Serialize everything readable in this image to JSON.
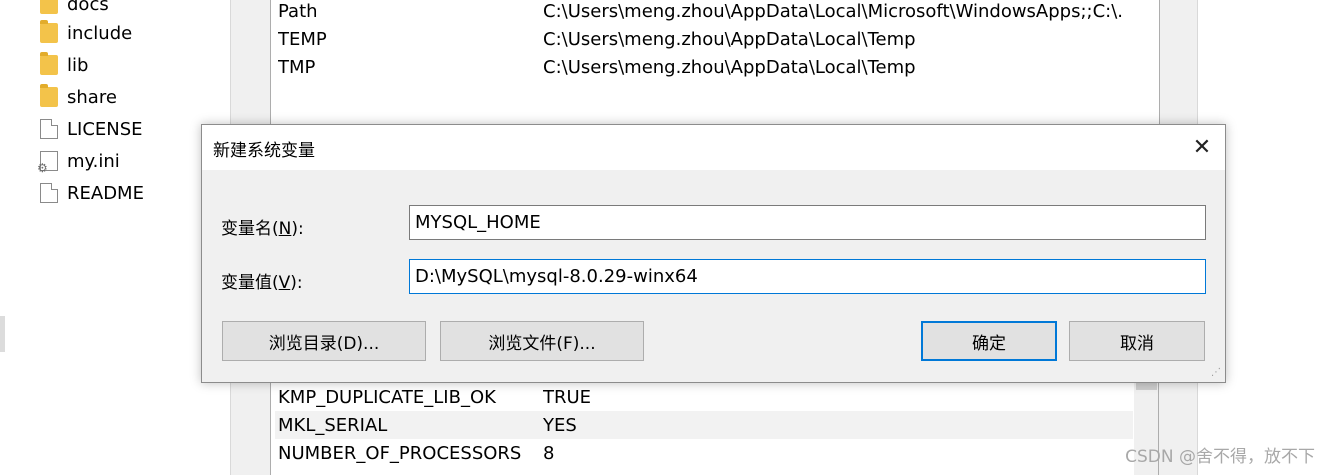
{
  "explorer": {
    "items": [
      {
        "label": "docs",
        "icon": "folder-icon"
      },
      {
        "label": "include",
        "icon": "folder-icon"
      },
      {
        "label": "lib",
        "icon": "folder-icon"
      },
      {
        "label": "share",
        "icon": "folder-icon"
      },
      {
        "label": "LICENSE",
        "icon": "file-icon"
      },
      {
        "label": "my.ini",
        "icon": "config-file-icon"
      },
      {
        "label": "README",
        "icon": "file-icon"
      }
    ]
  },
  "user_variables": {
    "rows": [
      {
        "name": "Path",
        "value": "C:\\Users\\meng.zhou\\AppData\\Local\\Microsoft\\WindowsApps;;C:\\..."
      },
      {
        "name": "TEMP",
        "value": "C:\\Users\\meng.zhou\\AppData\\Local\\Temp"
      },
      {
        "name": "TMP",
        "value": "C:\\Users\\meng.zhou\\AppData\\Local\\Temp"
      }
    ]
  },
  "system_variables": {
    "rows": [
      {
        "name": "KMP_DUPLICATE_LIB_OK",
        "value": "TRUE"
      },
      {
        "name": "MKL_SERIAL",
        "value": "YES"
      },
      {
        "name": "NUMBER_OF_PROCESSORS",
        "value": "8"
      }
    ]
  },
  "dialog": {
    "title": "新建系统变量",
    "close_glyph": "✕",
    "name_label_prefix": "变量名(",
    "name_label_key": "N",
    "name_label_suffix": "):",
    "name_value": "MYSQL_HOME",
    "value_label_prefix": "变量值(",
    "value_label_key": "V",
    "value_label_suffix": "):",
    "value_value": "D:\\MySQL\\mysql-8.0.29-winx64",
    "browse_dir_label": "浏览目录(D)...",
    "browse_file_label": "浏览文件(F)...",
    "ok_label": "确定",
    "cancel_label": "取消"
  },
  "watermark": "CSDN @舍不得，放不下",
  "colors": {
    "accent": "#0078d7",
    "button_bg": "#e1e1e1",
    "dialog_bg": "#f0f0f0"
  }
}
